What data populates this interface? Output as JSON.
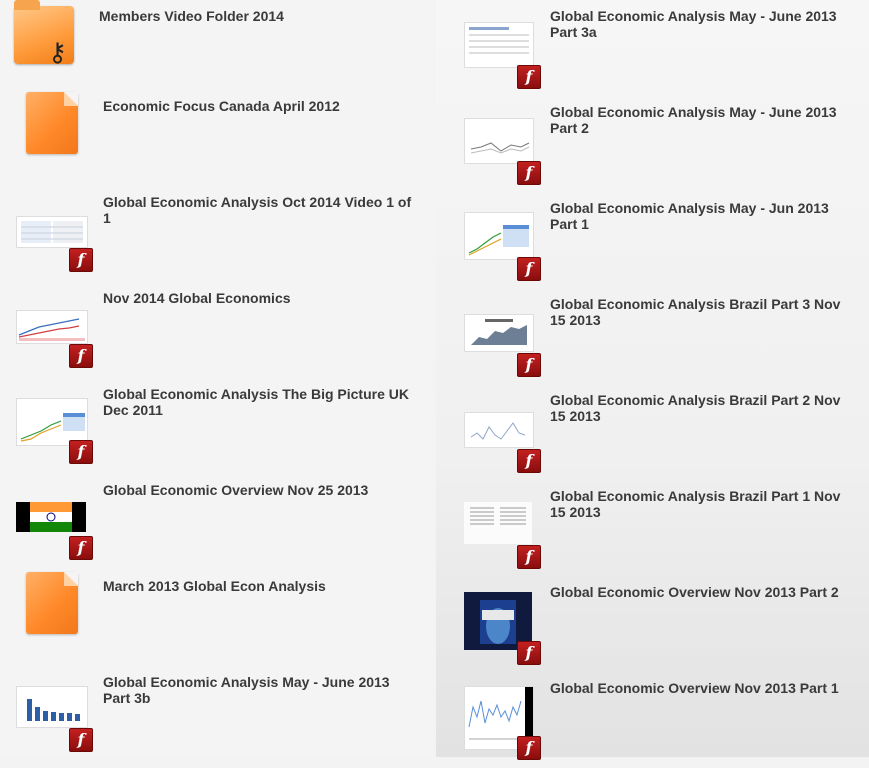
{
  "left_items": [
    {
      "title": "Members Video Folder 2014",
      "thumb": "folder-key-icon"
    },
    {
      "title": "Economic Focus Canada April 2012",
      "thumb": "document-icon"
    },
    {
      "title": "Global Economic Analysis Oct 2014 Video 1 of 1",
      "thumb": "flash-video"
    },
    {
      "title": "Nov 2014 Global Economics",
      "thumb": "flash-video"
    },
    {
      "title": "Global Economic Analysis The Big Picture UK Dec 2011",
      "thumb": "flash-video"
    },
    {
      "title": "Global Economic Overview Nov 25 2013",
      "thumb": "flash-video"
    },
    {
      "title": "March 2013 Global Econ Analysis",
      "thumb": "document-icon"
    },
    {
      "title": "Global Economic Analysis May - June 2013 Part 3b",
      "thumb": "flash-video"
    }
  ],
  "right_items": [
    {
      "title": "Global Economic Analysis May - June 2013 Part 3a",
      "thumb": "flash-video"
    },
    {
      "title": "Global Economic Analysis May - June 2013 Part 2",
      "thumb": "flash-video"
    },
    {
      "title": "Global Economic Analysis May - Jun 2013 Part 1",
      "thumb": "flash-video"
    },
    {
      "title": "Global Economic Analysis Brazil Part 3 Nov 15 2013",
      "thumb": "flash-video"
    },
    {
      "title": "Global Economic Analysis Brazil Part 2 Nov 15 2013",
      "thumb": "flash-video"
    },
    {
      "title": "Global Economic Analysis Brazil Part 1 Nov 15 2013",
      "thumb": "flash-video"
    },
    {
      "title": "Global Economic Overview Nov 2013 Part 2",
      "thumb": "flash-video"
    },
    {
      "title": "Global Economic Overview Nov 2013 Part 1",
      "thumb": "flash-video"
    }
  ],
  "badge": {
    "flash_glyph": "f"
  },
  "colors": {
    "flash_badge": "#b01818",
    "title_text": "#3a3a3a",
    "file_orange": "#ff8a2a"
  }
}
